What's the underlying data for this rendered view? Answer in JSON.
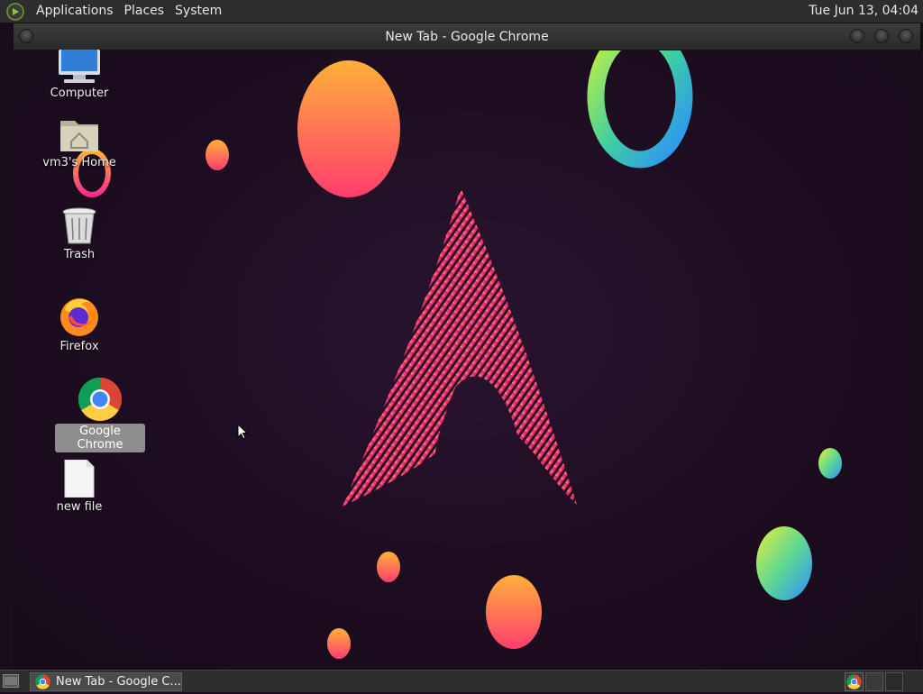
{
  "top_panel": {
    "menus": [
      "Applications",
      "Places",
      "System"
    ],
    "clock": "Tue Jun 13, 04:04"
  },
  "window": {
    "title": "New Tab - Google Chrome"
  },
  "desktop_icons": {
    "computer": "Computer",
    "home": "vm3's Home",
    "trash": "Trash",
    "firefox": "Firefox",
    "chrome": "Google Chrome",
    "new_file": "new file"
  },
  "taskbar": {
    "chrome_task": "New Tab - Google C..."
  },
  "icons": {
    "menu_logo": "mate-logo-icon",
    "show_desktop": "show-desktop-icon",
    "chrome": "chrome-icon",
    "firefox": "firefox-icon"
  },
  "colors": {
    "panel": "#2d2d2d",
    "wallpaper": "#1d0d20",
    "selection": "#8e8e8e"
  }
}
